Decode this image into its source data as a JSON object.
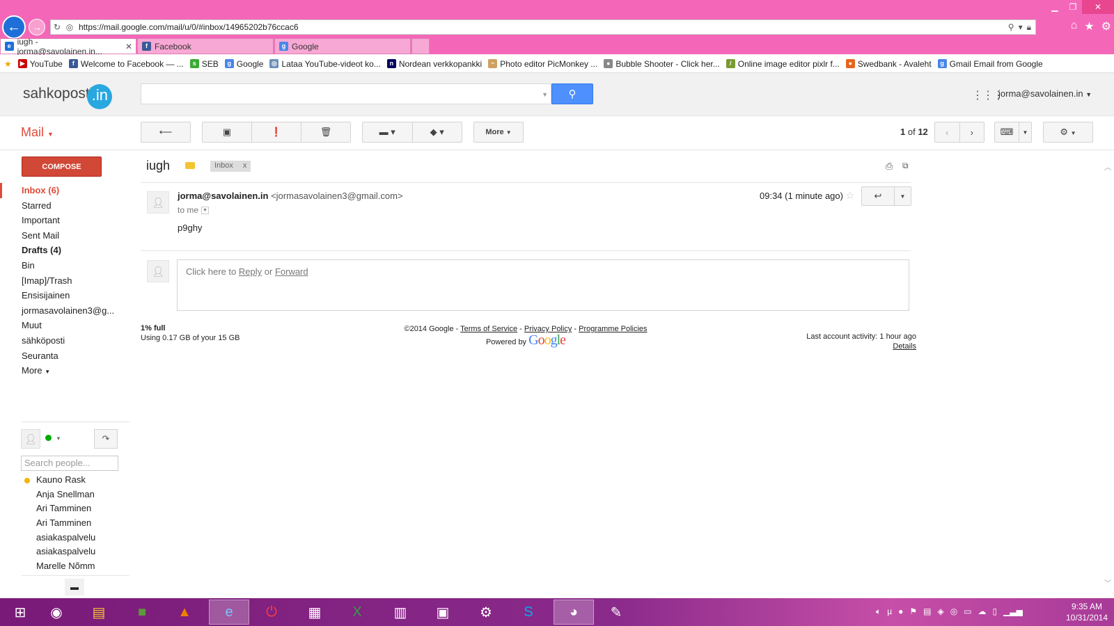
{
  "browser": {
    "url": "https://mail.google.com/mail/u/0/#inbox/14965202b76ccac6",
    "tabs": [
      {
        "label": "iugh - jorma@savolainen.in...",
        "active": true
      },
      {
        "label": "Facebook",
        "active": false
      },
      {
        "label": "Google",
        "active": false
      }
    ],
    "bookmarks": [
      "YouTube",
      "Welcome to Facebook — ...",
      "SEB",
      "Google",
      "Lataa YouTube-videot ko...",
      "Nordean verkkopankki",
      "Photo editor  PicMonkey ...",
      "Bubble Shooter - Click her...",
      "Online image editor pixlr f...",
      "Swedbank - Avaleht",
      "Gmail Email from Google"
    ]
  },
  "header": {
    "logo_text": "sahkoposti",
    "logo_badge": ".in",
    "account": "jorma@savolainen.in"
  },
  "toolbar": {
    "mail_label": "Mail",
    "more_label": "More",
    "pager_current": "1",
    "pager_of": "of",
    "pager_total": "12"
  },
  "sidebar": {
    "compose_label": "COMPOSE",
    "items": [
      {
        "label": "Inbox (6)"
      },
      {
        "label": "Starred"
      },
      {
        "label": "Important"
      },
      {
        "label": "Sent Mail"
      },
      {
        "label": "Drafts (4)"
      },
      {
        "label": "Bin"
      },
      {
        "label": "[Imap]/Trash"
      },
      {
        "label": "Ensisijainen"
      },
      {
        "label": "jormasavolainen3@g..."
      },
      {
        "label": "Muut"
      },
      {
        "label": "sähköposti"
      },
      {
        "label": "Seuranta"
      },
      {
        "label": "More"
      }
    ],
    "search_people_placeholder": "Search people...",
    "contacts": [
      "Kauno Rask",
      "Anja Snellman",
      "Ari Tamminen",
      "Ari Tamminen",
      "asiakaspalvelu",
      "asiakaspalvelu",
      "Marelle Nõmm"
    ]
  },
  "message": {
    "subject": "iugh",
    "label": "Inbox",
    "label_remove": "x",
    "sender_name": "jorma@savolainen.in",
    "sender_email": "<jormasavolainen3@gmail.com>",
    "to": "to me",
    "time": "09:34 (1 minute ago)",
    "body": "p9ghy",
    "reply_prefix": "Click here to",
    "reply_link": "Reply",
    "reply_or": "or",
    "forward_link": "Forward"
  },
  "footer": {
    "storage_pct": "1% full",
    "storage_used": "Using 0.17 GB of your 15 GB",
    "copyright": "©2014 Google -",
    "terms": "Terms of Service",
    "privacy": "Privacy Policy",
    "policies": "Programme Policies",
    "powered_by": "Powered by",
    "google_logo": "Google",
    "last_activity": "Last account activity: 1 hour ago",
    "details": "Details"
  },
  "taskbar": {
    "time": "9:35 AM",
    "date": "10/31/2014"
  },
  "colors": {
    "chrome": "#f467b8",
    "compose": "#d14836",
    "search": "#4d90fe",
    "accent_red": "#dd4b39",
    "taskbar": "#7a1a78"
  }
}
